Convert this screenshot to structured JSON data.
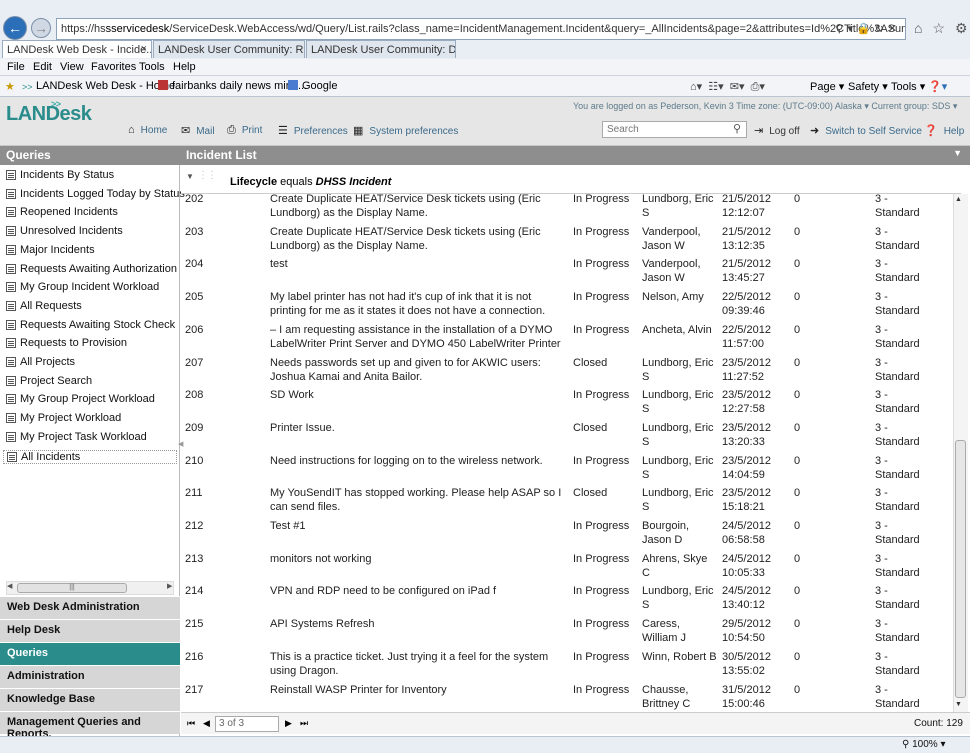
{
  "browser": {
    "url_prefix": "https://hs",
    "url_host": "sservicedesk",
    "url_rest": "/ServiceDesk.WebAccess/wd/Query/List.rails?class_name=IncidentManagement.Incident&query=_AllIncidents&page=2&attributes=Id%2CTitle%3ASummary%2CStatus.",
    "tabs": [
      {
        "label": "LANDesk Web Desk - Incide..."
      },
      {
        "label": "LANDesk User Community: Re..."
      },
      {
        "label": "LANDesk User Community: Da..."
      }
    ],
    "menus": [
      "File",
      "Edit",
      "View",
      "Favorites",
      "Tools",
      "Help"
    ],
    "favorites": [
      "LANDesk Web Desk - Home",
      "fairbanks daily news mine...",
      "Google"
    ],
    "commands": [
      "Page",
      "Safety",
      "Tools"
    ],
    "zoom": "100%"
  },
  "app": {
    "logo": "LANDesk",
    "user_info": "You are logged on as Pederson, Kevin 3    Time zone: (UTC-09:00) Alaska ▾    Current group: SDS ▾",
    "nav": [
      "Home",
      "Mail",
      "Print",
      "Preferences",
      "System preferences"
    ],
    "search_placeholder": "Search",
    "logoff": "Log off",
    "switch": "Switch to Self Service",
    "help": "Help"
  },
  "sidebar": {
    "title": "Queries",
    "queries": [
      "Incidents By Status",
      "Incidents Logged Today by Status",
      "Reopened Incidents",
      "Unresolved Incidents",
      "Major Incidents",
      "Requests Awaiting Authorization",
      "My Group Incident Workload",
      "All Requests",
      "Requests Awaiting Stock Check",
      "Requests to Provision",
      "All Projects",
      "Project Search",
      "My Group Project Workload",
      "My Project Workload",
      "My Project Task Workload",
      "All Incidents"
    ],
    "sections": [
      "Web Desk Administration",
      "Help Desk",
      "Queries",
      "Administration",
      "Knowledge Base",
      "Management Queries and Reports."
    ]
  },
  "main": {
    "title": "Incident List",
    "filter_field": "Lifecycle",
    "filter_op": "equals",
    "filter_value": "DHSS Incident",
    "rows": [
      {
        "id": "202",
        "summary": "Create Duplicate HEAT/Service Desk tickets using (Eric Lundborg) as the Display Name.",
        "status": "In Progress",
        "assignee": "Lundborg, Eric S",
        "date": "21/5/2012 12:12:07",
        "n": "0",
        "priority": "3 - Standard"
      },
      {
        "id": "203",
        "summary": "Create Duplicate HEAT/Service Desk tickets using (Eric Lundborg) as the Display Name.",
        "status": "In Progress",
        "assignee": "Vanderpool, Jason W",
        "date": "21/5/2012 13:12:35",
        "n": "0",
        "priority": "3 - Standard"
      },
      {
        "id": "204",
        "summary": "test",
        "status": "In Progress",
        "assignee": "Vanderpool, Jason W",
        "date": "21/5/2012 13:45:27",
        "n": "0",
        "priority": "3 - Standard"
      },
      {
        "id": "205",
        "summary": "My label printer has not had it's cup of ink that it is not printing for me as it states it does not have a connection.",
        "status": "In Progress",
        "assignee": "Nelson, Amy",
        "date": "22/5/2012 09:39:46",
        "n": "0",
        "priority": "3 - Standard"
      },
      {
        "id": "206",
        "summary": "– I am requesting assistance in the installation of a DYMO LabelWriter Print Server and DYMO 450 LabelWriter Printer",
        "status": "In Progress",
        "assignee": "Ancheta, Alvin",
        "date": "22/5/2012 11:57:00",
        "n": "0",
        "priority": "3 - Standard"
      },
      {
        "id": "207",
        "summary": "Needs passwords set up and given to for AKWIC users: Joshua Kamai and Anita Bailor.",
        "status": "Closed",
        "assignee": "Lundborg, Eric S",
        "date": "23/5/2012 11:27:52",
        "n": "0",
        "priority": "3 - Standard"
      },
      {
        "id": "208",
        "summary": "SD Work",
        "status": "In Progress",
        "assignee": "Lundborg, Eric S",
        "date": "23/5/2012 12:27:58",
        "n": "0",
        "priority": "3 - Standard"
      },
      {
        "id": "209",
        "summary": "Printer Issue.",
        "status": "Closed",
        "assignee": "Lundborg, Eric S",
        "date": "23/5/2012 13:20:33",
        "n": "0",
        "priority": "3 - Standard"
      },
      {
        "id": "210",
        "summary": "Need instructions for logging on to the wireless network.",
        "status": "In Progress",
        "assignee": "Lundborg, Eric S",
        "date": "23/5/2012 14:04:59",
        "n": "0",
        "priority": "3 - Standard"
      },
      {
        "id": "211",
        "summary": "My YouSendIT has stopped working. Please help ASAP so I can send files.",
        "status": "Closed",
        "assignee": "Lundborg, Eric S",
        "date": "23/5/2012 15:18:21",
        "n": "0",
        "priority": "3 - Standard"
      },
      {
        "id": "212",
        "summary": "Test #1",
        "status": "In Progress",
        "assignee": "Bourgoin, Jason D",
        "date": "24/5/2012 06:58:58",
        "n": "0",
        "priority": "3 - Standard"
      },
      {
        "id": "213",
        "summary": "monitors not working",
        "status": "In Progress",
        "assignee": "Ahrens, Skye C",
        "date": "24/5/2012 10:05:33",
        "n": "0",
        "priority": "3 - Standard"
      },
      {
        "id": "214",
        "summary": "VPN and RDP need to be configured on iPad f",
        "status": "In Progress",
        "assignee": "Lundborg, Eric S",
        "date": "24/5/2012 13:40:12",
        "n": "0",
        "priority": "3 - Standard"
      },
      {
        "id": "215",
        "summary": "API Systems Refresh",
        "status": "In Progress",
        "assignee": "Caress, William J",
        "date": "29/5/2012 10:54:50",
        "n": "0",
        "priority": "3 - Standard"
      },
      {
        "id": "216",
        "summary": "This is a practice ticket. Just trying it a feel for the system using Dragon.",
        "status": "In Progress",
        "assignee": "Winn, Robert B",
        "date": "30/5/2012 13:55:02",
        "n": "0",
        "priority": "3 - Standard"
      },
      {
        "id": "217",
        "summary": "Reinstall WASP Printer for Inventory",
        "status": "In Progress",
        "assignee": "Chausse, Brittney C",
        "date": "31/5/2012 15:00:46",
        "n": "0",
        "priority": "3 - Standard"
      }
    ],
    "page_text": "3 of 3",
    "count": "Count: 129"
  }
}
